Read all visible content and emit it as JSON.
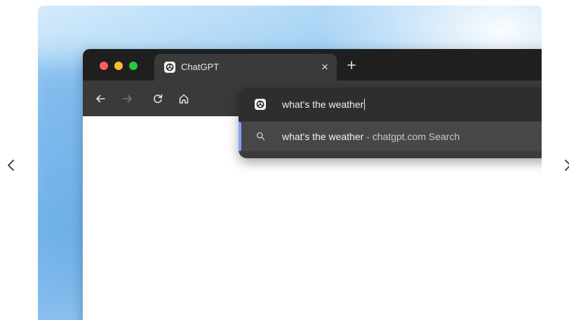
{
  "browser": {
    "tab": {
      "title": "ChatGPT",
      "close_symbol": "×"
    },
    "new_tab_icon": "plus-icon",
    "toolbar": {
      "back_icon": "arrow-left-icon",
      "forward_icon": "arrow-right-icon",
      "reload_icon": "reload-icon",
      "home_icon": "home-icon"
    },
    "omnibox": {
      "value": "what's the weather",
      "suggestion": {
        "query": "what's the weather",
        "separator": " - ",
        "source": "chatgpt.com Search"
      }
    }
  },
  "carousel": {
    "prev_icon": "chevron-left-icon",
    "next_icon": "chevron-right-icon"
  },
  "colors": {
    "tabbar_bg": "#1f1f1f",
    "toolbar_bg": "#3a3a3a",
    "suggestion_accent": "#7aa6f5",
    "traffic_red": "#ff5f57",
    "traffic_yellow": "#febc2e",
    "traffic_green": "#28c840"
  }
}
